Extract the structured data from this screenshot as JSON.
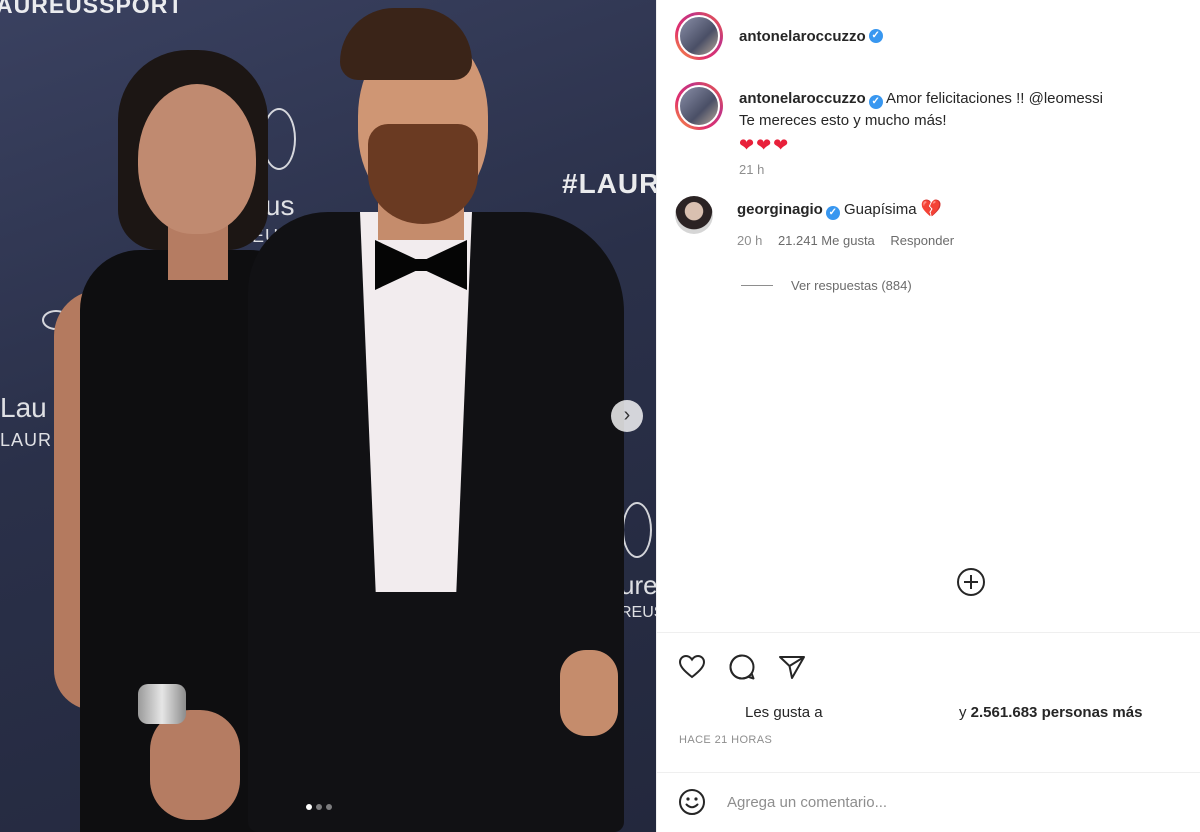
{
  "photo": {
    "sign_top": "AUREUSSPORT",
    "sign_hashtag": "#LAUR",
    "sign_center_a": "reus",
    "sign_center_b": "REUSSPORT",
    "sign_left_a": "Lau",
    "sign_left_b": "LAUR",
    "sign_right_a": "ure",
    "sign_right_b": "REUSS",
    "next_icon": "chevron-right-icon",
    "carousel_dots": 3,
    "carousel_active_index": 0
  },
  "post": {
    "author": "antonelaroccuzzo",
    "verified": true
  },
  "caption": {
    "username": "antonelaroccuzzo",
    "text_before_mention": "Amor felicitaciones !! ",
    "mention": "@leomessi",
    "line2": "Te mereces esto y mucho más!",
    "hearts": "❤❤❤",
    "time": "21 h"
  },
  "comment": {
    "username": "georginagio",
    "text": "Guapísima",
    "emoji": "💔",
    "time": "20 h",
    "likes": "21.241 Me gusta",
    "reply_label": "Responder",
    "view_replies": "Ver respuestas (884)"
  },
  "more_icon": "plus-circle-icon",
  "actions": {
    "like_icon": "heart-icon",
    "comment_icon": "comment-icon",
    "share_icon": "send-icon"
  },
  "likes": {
    "prefix": "Les gusta a",
    "suffix_y": "y",
    "count_text": "2.561.683 personas más"
  },
  "timestamp": "HACE 21 HORAS",
  "add_comment": {
    "emoji_icon": "smiley-icon",
    "placeholder": "Agrega un comentario..."
  },
  "colors": {
    "verified_blue": "#3897f0",
    "heart_red": "#e8203a",
    "muted_text": "#8e8e8e",
    "photo_backdrop": "#2a3049"
  }
}
